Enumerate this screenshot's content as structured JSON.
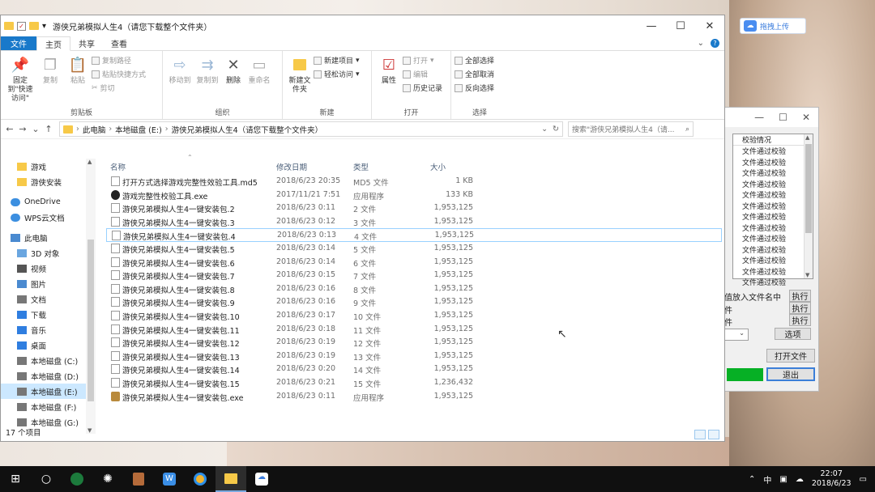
{
  "desktop": {
    "cloud_button_label": "拖拽上传"
  },
  "checker": {
    "list_header": "校验情况",
    "list_items": [
      "文件通过校验",
      "文件通过校验",
      "文件通过校验",
      "文件通过校验",
      "文件通过校验",
      "文件通过校验",
      "文件通过校验",
      "文件通过校验",
      "文件通过校验",
      "文件通过校验",
      "文件通过校验",
      "文件通过校验",
      "文件通过校验"
    ],
    "option1_label": "值放入文件名中",
    "option2_label": "件",
    "option3_label": "件",
    "run_label": "执行",
    "options_label": "选项",
    "open_file_label": "打开文件",
    "exit_label": "退出"
  },
  "explorer": {
    "title": "游侠兄弟模拟人生4（请您下载整个文件夹）",
    "tabs": {
      "file": "文件",
      "home": "主页",
      "share": "共享",
      "view": "查看"
    },
    "ribbon": {
      "pin_label": "固定到\"快速访问\"",
      "copy_label": "复制",
      "paste_label": "粘贴",
      "copy_path_label": "复制路径",
      "paste_shortcut_label": "粘贴快捷方式",
      "cut_label": "剪切",
      "clipboard_group": "剪贴板",
      "move_to_label": "移动到",
      "copy_to_label": "复制到",
      "delete_label": "删除",
      "rename_label": "重命名",
      "organize_group": "组织",
      "new_folder_label": "新建文件夹",
      "new_item_label": "新建项目",
      "easy_access_label": "轻松访问",
      "new_group": "新建",
      "properties_label": "属性",
      "open_label": "打开",
      "edit_label": "编辑",
      "history_label": "历史记录",
      "open_group": "打开",
      "select_all_label": "全部选择",
      "select_none_label": "全部取消",
      "invert_label": "反向选择",
      "select_group": "选择"
    },
    "address": {
      "crumbs": [
        "此电脑",
        "本地磁盘 (E:)",
        "游侠兄弟模拟人生4（请您下载整个文件夹）"
      ],
      "search_placeholder": "搜索\"游侠兄弟模拟人生4（请..."
    },
    "sidebar": [
      {
        "label": "游戏",
        "icon": "folder"
      },
      {
        "label": "游侠安装",
        "icon": "folder"
      },
      {
        "label": "OneDrive",
        "icon": "cloud"
      },
      {
        "label": "WPS云文档",
        "icon": "cloud"
      },
      {
        "label": "此电脑",
        "icon": "computer"
      },
      {
        "label": "3D 对象",
        "icon": "cube"
      },
      {
        "label": "视频",
        "icon": "video"
      },
      {
        "label": "图片",
        "icon": "picture"
      },
      {
        "label": "文档",
        "icon": "document"
      },
      {
        "label": "下载",
        "icon": "download"
      },
      {
        "label": "音乐",
        "icon": "music"
      },
      {
        "label": "桌面",
        "icon": "desktop"
      },
      {
        "label": "本地磁盘 (C:)",
        "icon": "drive"
      },
      {
        "label": "本地磁盘 (D:)",
        "icon": "drive"
      },
      {
        "label": "本地磁盘 (E:)",
        "icon": "drive"
      },
      {
        "label": "本地磁盘 (F:)",
        "icon": "drive"
      },
      {
        "label": "本地磁盘 (G:)",
        "icon": "drive"
      }
    ],
    "columns": {
      "name": "名称",
      "date": "修改日期",
      "type": "类型",
      "size": "大小"
    },
    "files": [
      {
        "name": "打开方式选择游戏完整性效验工具.md5",
        "date": "2018/6/23 20:35",
        "type": "MD5 文件",
        "size": "1 KB",
        "icon": "file"
      },
      {
        "name": "游戏完整性校验工具.exe",
        "date": "2017/11/21 7:51",
        "type": "应用程序",
        "size": "133 KB",
        "icon": "exe"
      },
      {
        "name": "游侠兄弟模拟人生4一键安装包.2",
        "date": "2018/6/23 0:11",
        "type": "2 文件",
        "size": "1,953,125",
        "icon": "file"
      },
      {
        "name": "游侠兄弟模拟人生4一键安装包.3",
        "date": "2018/6/23 0:12",
        "type": "3 文件",
        "size": "1,953,125",
        "icon": "file"
      },
      {
        "name": "游侠兄弟模拟人生4一键安装包.4",
        "date": "2018/6/23 0:13",
        "type": "4 文件",
        "size": "1,953,125",
        "icon": "file"
      },
      {
        "name": "游侠兄弟模拟人生4一键安装包.5",
        "date": "2018/6/23 0:14",
        "type": "5 文件",
        "size": "1,953,125",
        "icon": "file"
      },
      {
        "name": "游侠兄弟模拟人生4一键安装包.6",
        "date": "2018/6/23 0:14",
        "type": "6 文件",
        "size": "1,953,125",
        "icon": "file"
      },
      {
        "name": "游侠兄弟模拟人生4一键安装包.7",
        "date": "2018/6/23 0:15",
        "type": "7 文件",
        "size": "1,953,125",
        "icon": "file"
      },
      {
        "name": "游侠兄弟模拟人生4一键安装包.8",
        "date": "2018/6/23 0:16",
        "type": "8 文件",
        "size": "1,953,125",
        "icon": "file"
      },
      {
        "name": "游侠兄弟模拟人生4一键安装包.9",
        "date": "2018/6/23 0:16",
        "type": "9 文件",
        "size": "1,953,125",
        "icon": "file"
      },
      {
        "name": "游侠兄弟模拟人生4一键安装包.10",
        "date": "2018/6/23 0:17",
        "type": "10 文件",
        "size": "1,953,125",
        "icon": "file"
      },
      {
        "name": "游侠兄弟模拟人生4一键安装包.11",
        "date": "2018/6/23 0:18",
        "type": "11 文件",
        "size": "1,953,125",
        "icon": "file"
      },
      {
        "name": "游侠兄弟模拟人生4一键安装包.12",
        "date": "2018/6/23 0:19",
        "type": "12 文件",
        "size": "1,953,125",
        "icon": "file"
      },
      {
        "name": "游侠兄弟模拟人生4一键安装包.13",
        "date": "2018/6/23 0:19",
        "type": "13 文件",
        "size": "1,953,125",
        "icon": "file"
      },
      {
        "name": "游侠兄弟模拟人生4一键安装包.14",
        "date": "2018/6/23 0:20",
        "type": "14 文件",
        "size": "1,953,125",
        "icon": "file"
      },
      {
        "name": "游侠兄弟模拟人生4一键安装包.15",
        "date": "2018/6/23 0:21",
        "type": "15 文件",
        "size": "1,236,432",
        "icon": "file"
      },
      {
        "name": "游侠兄弟模拟人生4一键安装包.exe",
        "date": "2018/6/23 0:11",
        "type": "应用程序",
        "size": "1,953,125",
        "icon": "app"
      }
    ],
    "status": "17 个项目"
  },
  "taskbar": {
    "ime": "中",
    "time": "22:07",
    "date": "2018/6/23"
  }
}
